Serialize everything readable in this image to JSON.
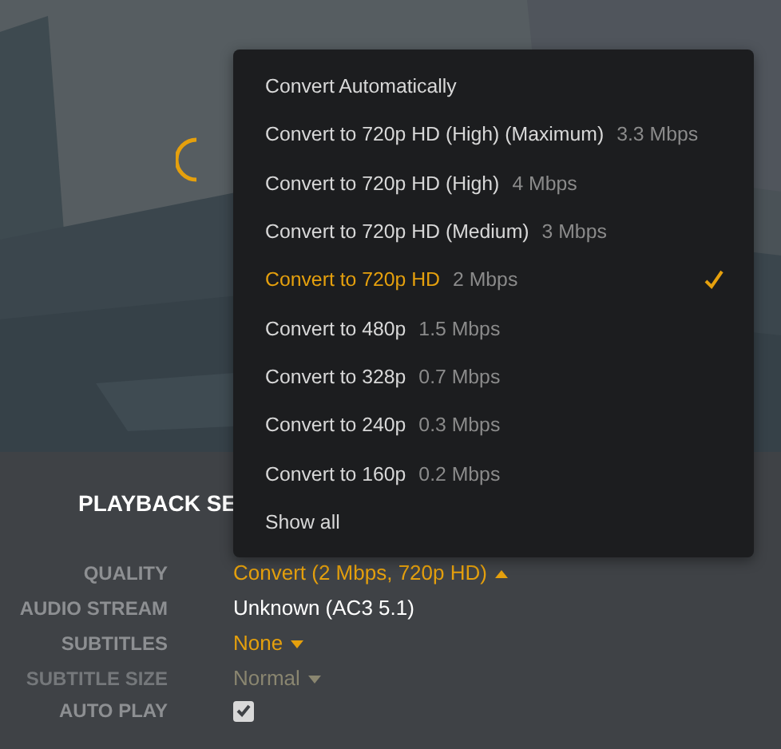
{
  "player": {
    "loading": true
  },
  "quality_menu": {
    "items": [
      {
        "label": "Convert Automatically",
        "selected": false
      },
      {
        "label": "Convert to 720p HD (High) (Maximum)",
        "detail": "3.3 Mbps",
        "selected": false
      },
      {
        "label": "Convert to 720p HD (High)",
        "detail": "4 Mbps",
        "selected": false
      },
      {
        "label": "Convert to 720p HD (Medium)",
        "detail": "3 Mbps",
        "selected": false
      },
      {
        "label": "Convert to 720p HD",
        "detail": "2 Mbps",
        "selected": true
      },
      {
        "label": "Convert to 480p",
        "detail": "1.5 Mbps",
        "selected": false
      },
      {
        "label": "Convert to 328p",
        "detail": "0.7 Mbps",
        "selected": false
      },
      {
        "label": "Convert to 240p",
        "detail": "0.3 Mbps",
        "selected": false
      },
      {
        "label": "Convert to 160p",
        "detail": "0.2 Mbps",
        "selected": false
      },
      {
        "label": "Show all",
        "selected": false
      }
    ]
  },
  "playback_settings": {
    "title": "PLAYBACK SE",
    "rows": [
      {
        "label": "QUALITY",
        "kind": "dropdown",
        "value": "Convert (2 Mbps, 720p HD)",
        "expanded": true,
        "disabled": false
      },
      {
        "label": "AUDIO STREAM",
        "kind": "text",
        "value": "Unknown (AC3 5.1)"
      },
      {
        "label": "SUBTITLES",
        "kind": "dropdown",
        "value": "None",
        "expanded": false,
        "disabled": false
      },
      {
        "label": "SUBTITLE SIZE",
        "kind": "dropdown",
        "value": "Normal",
        "expanded": false,
        "disabled": true
      },
      {
        "label": "AUTO PLAY",
        "kind": "checkbox",
        "checked": true
      }
    ]
  }
}
